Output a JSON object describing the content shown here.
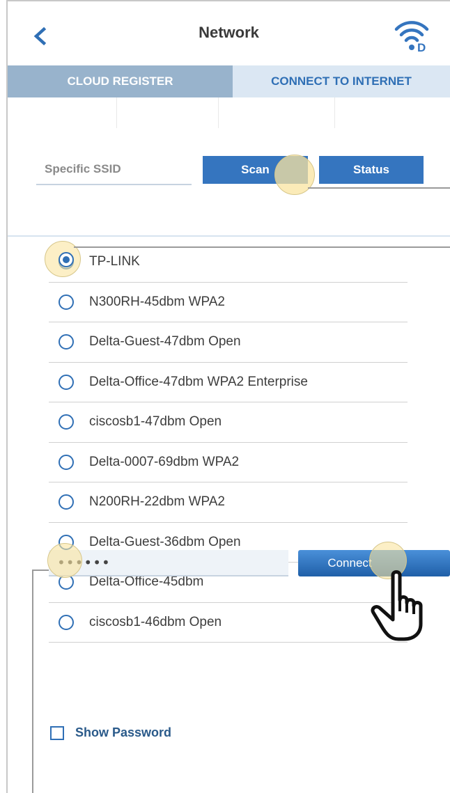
{
  "header": {
    "title": "Network",
    "back_icon": "chevron-left-icon",
    "status_icon": "wifi-d-icon"
  },
  "tabs": [
    {
      "label": "CLOUD REGISTER",
      "active": false
    },
    {
      "label": "CONNECT TO INTERNET",
      "active": true
    }
  ],
  "ssid": {
    "placeholder": "Specific SSID",
    "value": ""
  },
  "buttons": {
    "scan": "Scan",
    "status": "Status",
    "connect": "Connect"
  },
  "networks": [
    {
      "label": "TP-LINK",
      "selected": true
    },
    {
      "label": "N300RH-45dbm WPA2",
      "selected": false
    },
    {
      "label": "Delta-Guest-47dbm Open",
      "selected": false
    },
    {
      "label": "Delta-Office-47dbm WPA2 Enterprise",
      "selected": false
    },
    {
      "label": "ciscosb1-47dbm Open",
      "selected": false
    },
    {
      "label": "Delta-0007-69dbm WPA2",
      "selected": false
    },
    {
      "label": "N200RH-22dbm WPA2",
      "selected": false
    },
    {
      "label": "Delta-Guest-36dbm Open",
      "selected": false
    },
    {
      "label": "Delta-Office-45dbm",
      "selected": false
    },
    {
      "label": "ciscosb1-46dbm Open",
      "selected": false
    }
  ],
  "password": {
    "value": "••••••"
  },
  "show_password": {
    "label": "Show Password",
    "checked": false
  },
  "colors": {
    "accent": "#3575bf",
    "tab_inactive_bg": "#98b3cc",
    "tab_active_bg": "#dbe7f3",
    "tab_active_text": "#2f6fb5",
    "highlight_halo": "#fae4a0"
  }
}
